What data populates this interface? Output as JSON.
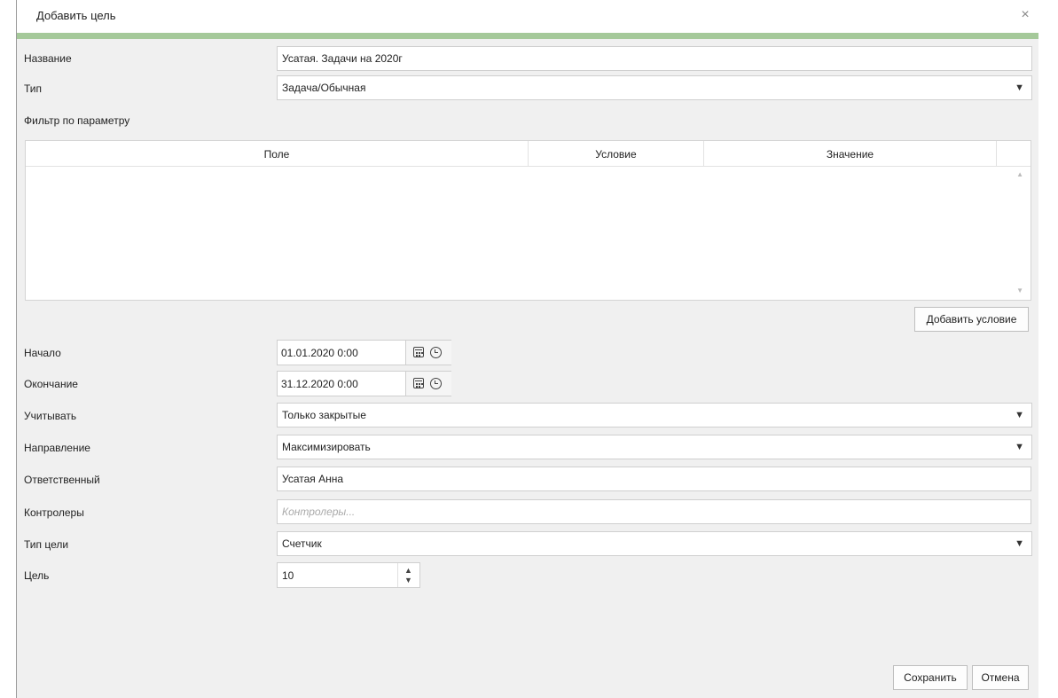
{
  "dialog": {
    "title": "Добавить цель",
    "close_glyph": "×"
  },
  "form": {
    "name_label": "Название",
    "name_value": "Усатая. Задачи на 2020г",
    "type_label": "Тип",
    "type_value": "Задача/Обычная",
    "filter_label": "Фильтр по параметру",
    "start_label": "Начало",
    "start_value": "01.01.2020 0:00",
    "end_label": "Окончание",
    "end_value": "31.12.2020 0:00",
    "count_label": "Учитывать",
    "count_value": "Только закрытые",
    "direction_label": "Направление",
    "direction_value": "Максимизировать",
    "owner_label": "Ответственный",
    "owner_value": "Усатая Анна",
    "controllers_label": "Контролеры",
    "controllers_placeholder": "Контролеры...",
    "goal_type_label": "Тип цели",
    "goal_type_value": "Счетчик",
    "goal_label": "Цель",
    "goal_value": "10"
  },
  "filter_table": {
    "columns": [
      "Поле",
      "Условие",
      "Значение"
    ],
    "rows": []
  },
  "buttons": {
    "add_condition": "Добавить условие",
    "save": "Сохранить",
    "cancel": "Отмена"
  },
  "icons": {
    "dropdown": "chevron-down-icon",
    "calendar": "calendar-icon",
    "clock": "clock-icon",
    "close": "close-icon"
  },
  "colors": {
    "accent_bar": "#a5c99a",
    "dialog_bg": "#f0f0f0"
  }
}
